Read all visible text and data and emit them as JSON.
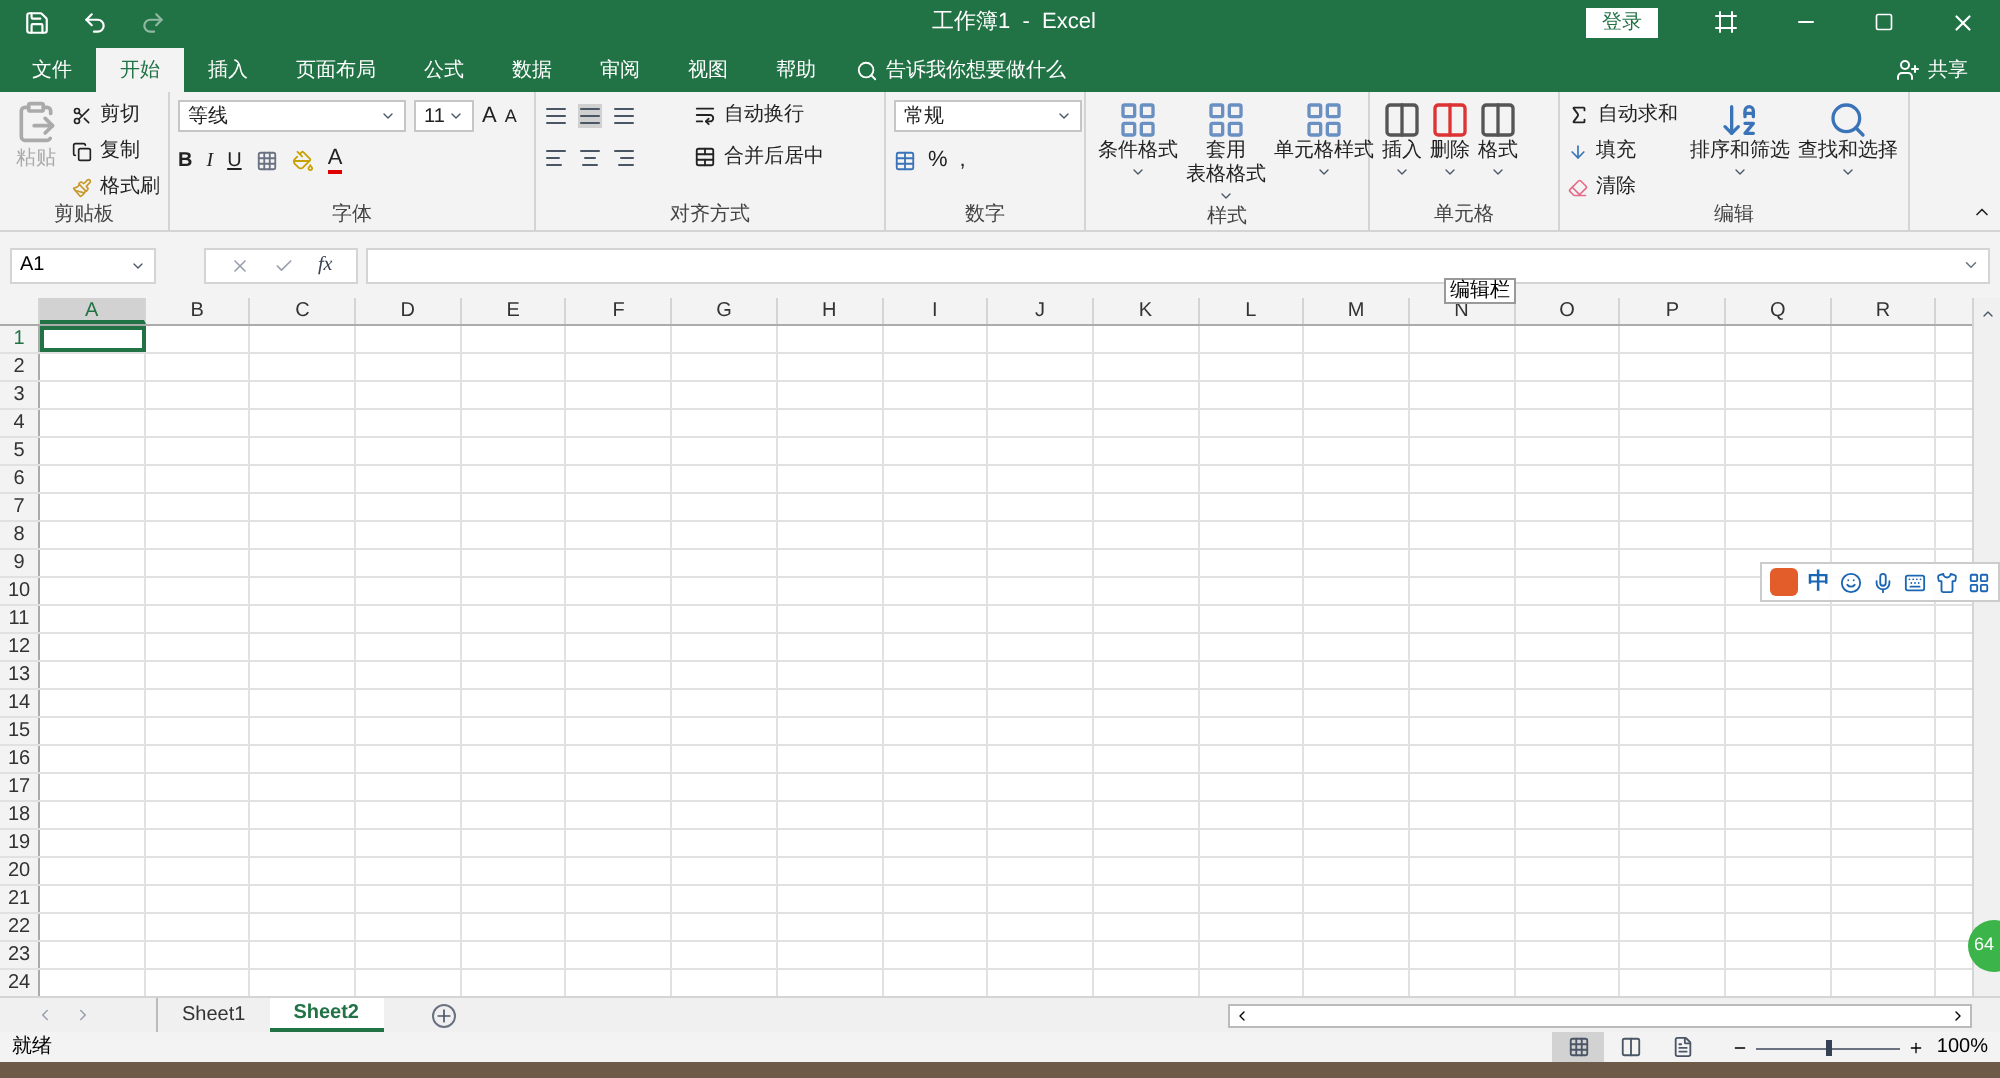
{
  "title_bar": {
    "title": "工作簿1  -  Excel",
    "login": "登录"
  },
  "ribbon_tabs": [
    {
      "label": "文件",
      "selected": false
    },
    {
      "label": "开始",
      "selected": true
    },
    {
      "label": "插入",
      "selected": false
    },
    {
      "label": "页面布局",
      "selected": false
    },
    {
      "label": "公式",
      "selected": false
    },
    {
      "label": "数据",
      "selected": false
    },
    {
      "label": "审阅",
      "selected": false
    },
    {
      "label": "视图",
      "selected": false
    },
    {
      "label": "帮助",
      "selected": false
    }
  ],
  "tell_me": "告诉我你想要做什么",
  "share": "共享",
  "clipboard": {
    "label": "剪贴板",
    "paste": "粘贴",
    "cut": "剪切",
    "copy": "复制",
    "format_painter": "格式刷"
  },
  "font": {
    "label": "字体",
    "font_name": "等线",
    "font_size": "11",
    "grow_font": "A",
    "shrink_font": "A",
    "bold": "B",
    "italic": "I",
    "underline": "U",
    "font_color": "A"
  },
  "alignment": {
    "label": "对齐方式",
    "wrap_text": "自动换行",
    "merge_center": "合并后居中"
  },
  "number": {
    "label": "数字",
    "format": "常规",
    "percent": "%",
    "comma": ","
  },
  "styles": {
    "label": "样式",
    "buttons": [
      {
        "lines": [
          "条件格式"
        ]
      },
      {
        "lines": [
          "套用",
          "表格格式"
        ]
      },
      {
        "lines": [
          "单元格样式"
        ]
      }
    ]
  },
  "cells": {
    "label": "单元格",
    "buttons": [
      "插入",
      "删除",
      "格式"
    ]
  },
  "editing": {
    "label": "编辑",
    "autosum": "自动求和",
    "fill": "填充",
    "clear": "清除",
    "sort_filter": "排序和筛选",
    "find_select": "查找和选择"
  },
  "formula_bar": {
    "name_box": "A1",
    "function_label": "fx"
  },
  "tooltip": "编辑栏",
  "columns": [
    {
      "label": "A",
      "selected": true
    },
    {
      "label": "B",
      "selected": false
    },
    {
      "label": "C",
      "selected": false
    },
    {
      "label": "D",
      "selected": false
    },
    {
      "label": "E",
      "selected": false
    },
    {
      "label": "F",
      "selected": false
    },
    {
      "label": "G",
      "selected": false
    },
    {
      "label": "H",
      "selected": false
    },
    {
      "label": "I",
      "selected": false
    },
    {
      "label": "J",
      "selected": false
    },
    {
      "label": "K",
      "selected": false
    },
    {
      "label": "L",
      "selected": false
    },
    {
      "label": "M",
      "selected": false
    },
    {
      "label": "N",
      "selected": false
    },
    {
      "label": "O",
      "selected": false
    },
    {
      "label": "P",
      "selected": false
    },
    {
      "label": "Q",
      "selected": false
    },
    {
      "label": "R",
      "selected": false
    }
  ],
  "rows": [
    {
      "label": "1",
      "selected": true
    },
    {
      "label": "2",
      "selected": false
    },
    {
      "label": "3",
      "selected": false
    },
    {
      "label": "4",
      "selected": false
    },
    {
      "label": "5",
      "selected": false
    },
    {
      "label": "6",
      "selected": false
    },
    {
      "label": "7",
      "selected": false
    },
    {
      "label": "8",
      "selected": false
    },
    {
      "label": "9",
      "selected": false
    },
    {
      "label": "10",
      "selected": false
    },
    {
      "label": "11",
      "selected": false
    },
    {
      "label": "12",
      "selected": false
    },
    {
      "label": "13",
      "selected": false
    },
    {
      "label": "14",
      "selected": false
    },
    {
      "label": "15",
      "selected": false
    },
    {
      "label": "16",
      "selected": false
    },
    {
      "label": "17",
      "selected": false
    },
    {
      "label": "18",
      "selected": false
    },
    {
      "label": "19",
      "selected": false
    },
    {
      "label": "20",
      "selected": false
    },
    {
      "label": "21",
      "selected": false
    },
    {
      "label": "22",
      "selected": false
    },
    {
      "label": "23",
      "selected": false
    },
    {
      "label": "24",
      "selected": false
    }
  ],
  "ime_toolbar": {
    "mode": "中"
  },
  "floating_badge": "64",
  "sheets": [
    {
      "name": "Sheet1",
      "selected": false
    },
    {
      "name": "Sheet2",
      "selected": true
    }
  ],
  "status_bar": {
    "status": "就绪",
    "views": [
      {
        "kind": "normal",
        "selected": true
      },
      {
        "kind": "page_layout",
        "selected": false
      },
      {
        "kind": "page_break",
        "selected": false
      }
    ],
    "zoom": {
      "level": 0.5,
      "reading": "100%"
    }
  }
}
